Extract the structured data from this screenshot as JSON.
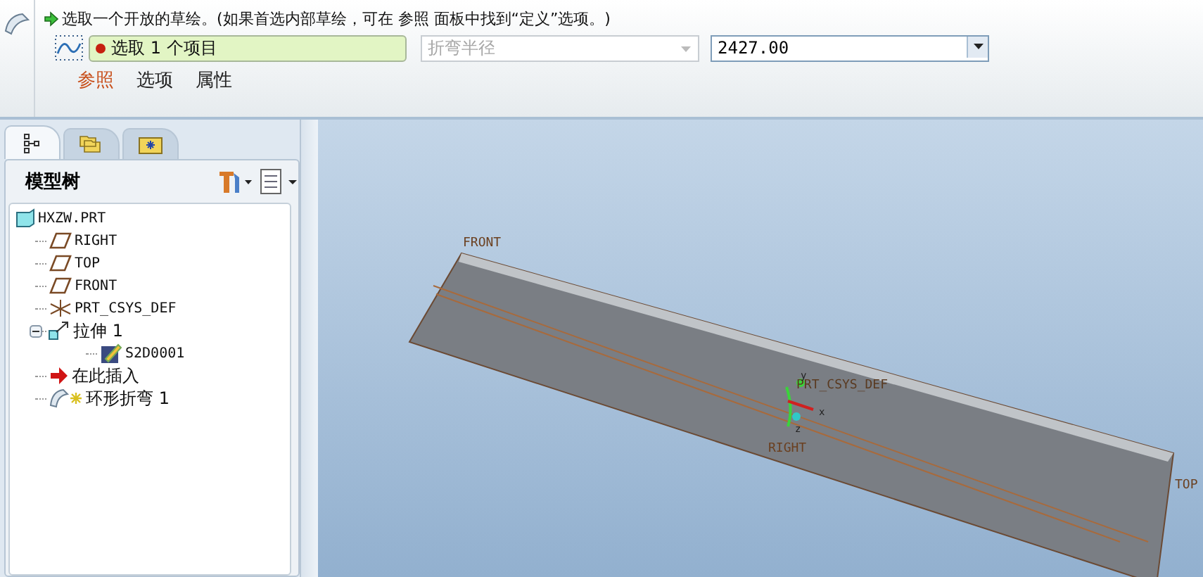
{
  "dashboard": {
    "message": "选取一个开放的草绘。(如果首选内部草绘，可在 参照 面板中找到“定义”选项。)",
    "selection": {
      "text": "选取 1 个项目"
    },
    "bend_type": {
      "placeholder": "折弯半径",
      "disabled": true
    },
    "radius": {
      "value": "2427.00"
    },
    "tabs": [
      {
        "label": "参照",
        "selected": true
      },
      {
        "label": "选项",
        "selected": false
      },
      {
        "label": "属性",
        "selected": false
      }
    ]
  },
  "navigator": {
    "tabs": [
      {
        "kind": "tree",
        "selected": true
      },
      {
        "kind": "folder",
        "selected": false
      },
      {
        "kind": "favorites",
        "selected": false
      }
    ],
    "title": "模型树",
    "tree": [
      {
        "label": "HXZW.PRT",
        "kind": "part",
        "children": [
          {
            "label": "RIGHT",
            "kind": "plane"
          },
          {
            "label": "TOP",
            "kind": "plane"
          },
          {
            "label": "FRONT",
            "kind": "plane"
          },
          {
            "label": "PRT_CSYS_DEF",
            "kind": "csys"
          },
          {
            "label": "拉伸 1",
            "kind": "extrude",
            "expanded": true,
            "children": [
              {
                "label": "S2D0001",
                "kind": "sketch"
              }
            ]
          },
          {
            "label": "在此插入",
            "kind": "insert"
          },
          {
            "label": "环形折弯 1",
            "kind": "bend"
          }
        ]
      }
    ]
  },
  "viewport": {
    "labels": [
      {
        "text": "FRONT",
        "kind": "datum"
      },
      {
        "text": "PRT_CSYS_DEF",
        "kind": "csys"
      },
      {
        "text": "RIGHT",
        "kind": "datum"
      },
      {
        "text": "TOP",
        "kind": "datum"
      }
    ],
    "axes": [
      "y",
      "x",
      "z"
    ]
  }
}
